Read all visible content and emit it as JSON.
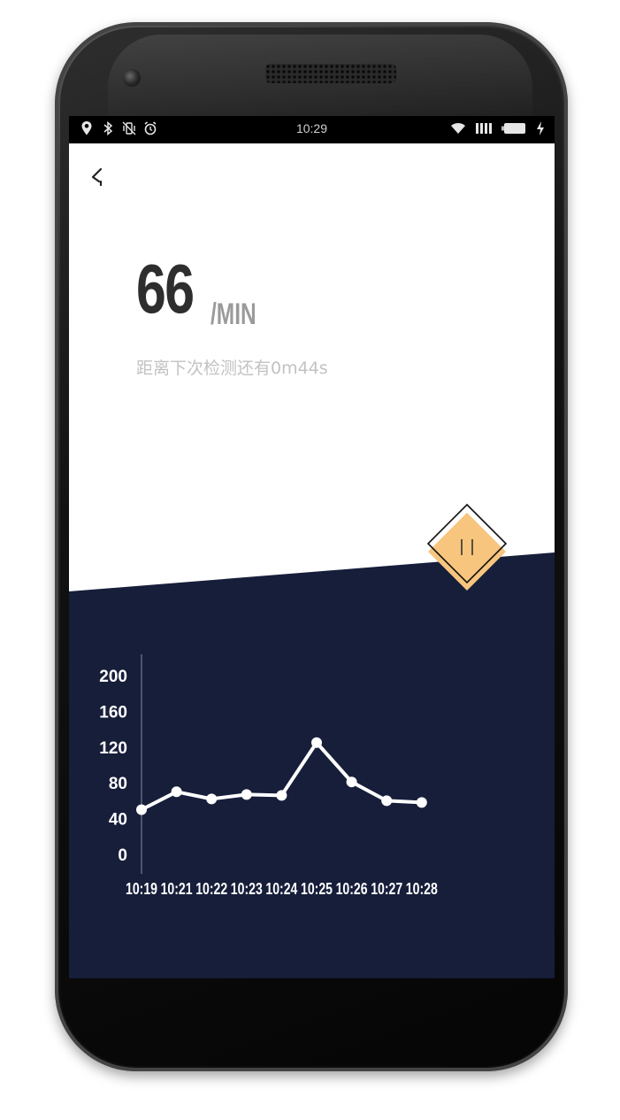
{
  "status_bar": {
    "time": "10:29",
    "left_icons": [
      "location-icon",
      "bluetooth-icon",
      "vibrate-off-icon",
      "alarm-icon"
    ],
    "right_icons": [
      "wifi-icon",
      "signal-icon",
      "battery-icon",
      "charging-icon"
    ]
  },
  "header": {
    "back_icon": "back-chevron-icon"
  },
  "reading": {
    "value": "66",
    "unit": "/MIN",
    "countdown": "距离下次检测还有0m44s"
  },
  "controls": {
    "pause_icon": "pause-icon",
    "accent_color": "#F7C57E"
  },
  "colors": {
    "panel": "#171E3A",
    "text_dark": "#2E2E2E",
    "text_muted": "#9A9A9A"
  },
  "chart_data": {
    "type": "line",
    "title": "",
    "xlabel": "",
    "ylabel": "",
    "ylim": [
      0,
      200
    ],
    "yticks": [
      "200",
      "160",
      "120",
      "80",
      "40",
      "0"
    ],
    "categories": [
      "10:19",
      "10:21",
      "10:22",
      "10:23",
      "10:24",
      "10:25",
      "10:26",
      "10:27",
      "10:28"
    ],
    "values": [
      50,
      70,
      62,
      67,
      66,
      125,
      81,
      60,
      58
    ],
    "grid": false,
    "legend": "none",
    "line_color": "#FFFFFF"
  }
}
